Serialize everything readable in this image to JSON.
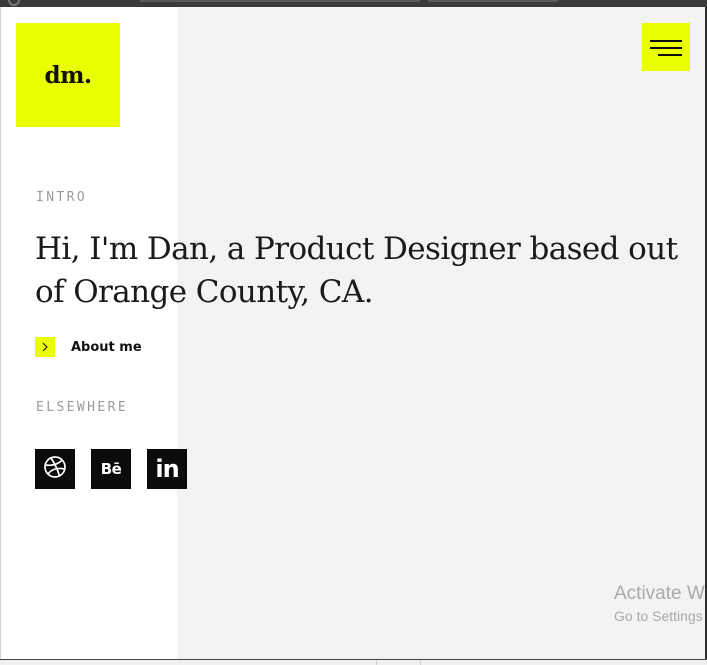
{
  "logo": {
    "text": "dm."
  },
  "menu": {
    "icon": "hamburger-menu-icon"
  },
  "intro": {
    "label": "INTRO",
    "headline": "Hi, I'm Dan, a Product Designer based out of Orange County, CA.",
    "about_label": "About me"
  },
  "elsewhere": {
    "label": "ELSEWHERE",
    "links": [
      {
        "name": "Dribbble",
        "icon": "dribbble-icon"
      },
      {
        "name": "Behance",
        "icon": "behance-icon",
        "glyph": "Bē"
      },
      {
        "name": "LinkedIn",
        "icon": "linkedin-icon",
        "glyph": "in"
      }
    ]
  },
  "watermark": {
    "line1": "Activate W",
    "line2": "Go to Settings"
  },
  "colors": {
    "accent": "#eaff00",
    "panel": "#f3f3f3",
    "text": "#1a1a1a",
    "muted": "#9a9a9a",
    "social_bg": "#0b0b0b"
  }
}
